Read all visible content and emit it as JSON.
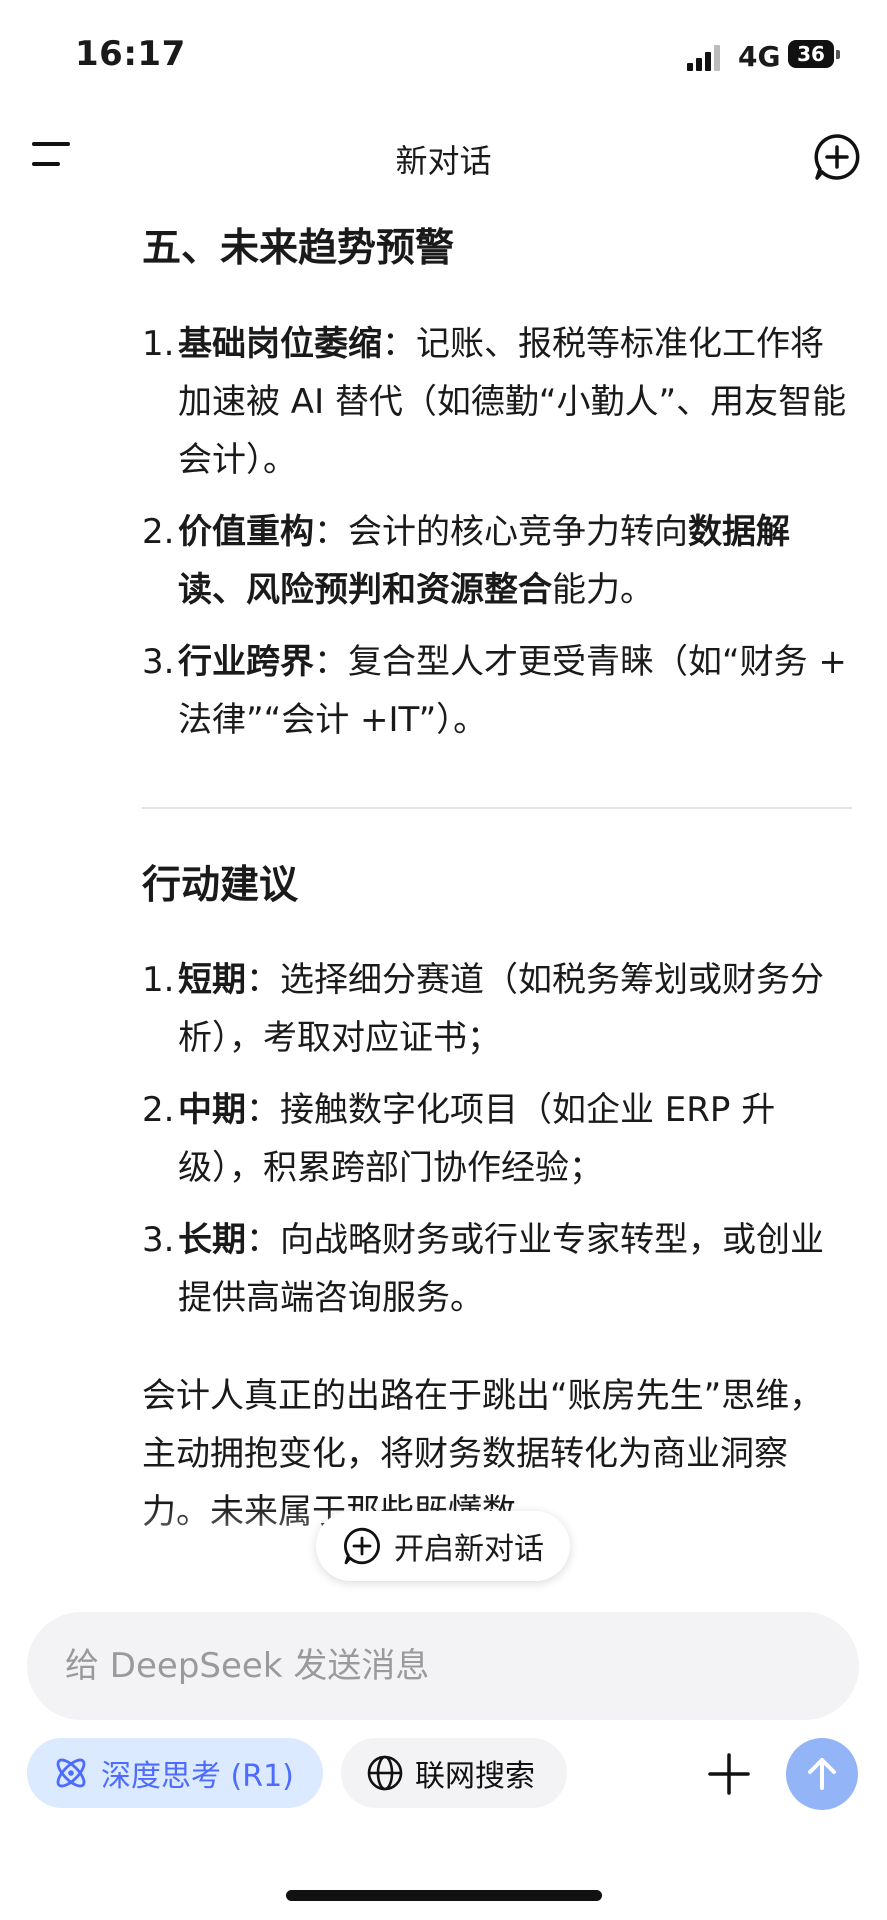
{
  "status_bar": {
    "time": "16:17",
    "network": "4G",
    "battery": "36"
  },
  "header": {
    "title": "新对话"
  },
  "section1": {
    "heading": "五、未来趋势预警",
    "items": [
      {
        "num": "1.",
        "bold": "基础岗位萎缩",
        "text": "：记账、报税等标准化工作将加速被 AI 替代（如德勤“小勤人”、用友智能会计）。"
      },
      {
        "num": "2.",
        "bold": "价值重构",
        "text_before": "：会计的核心竞争力转向",
        "bold2": "数据解读、风险预判和资源整合",
        "text_after": "能力。"
      },
      {
        "num": "3.",
        "bold": "行业跨界",
        "text": "：复合型人才更受青睐（如“财务 + 法律”“会计 +IT”）。"
      }
    ]
  },
  "section2": {
    "heading": "行动建议",
    "items": [
      {
        "num": "1.",
        "bold": "短期",
        "text": "：选择细分赛道（如税务筹划或财务分析），考取对应证书；"
      },
      {
        "num": "2.",
        "bold": "中期",
        "text": "：接触数字化项目（如企业 ERP 升级），积累跨部门协作经验；"
      },
      {
        "num": "3.",
        "bold": "长期",
        "text": "：向战略财务或行业专家转型，或创业提供高端咨询服务。"
      }
    ]
  },
  "final_paragraph": "会计人真正的出路在于跳出“账房先生”思维，主动拥抱变化，将财务数据转化为商业洞察力。未来属于那些既懂数",
  "floating_button": {
    "label": "开启新对话"
  },
  "composer": {
    "placeholder": "给 DeepSeek 发送消息",
    "deep_think_label": "深度思考 (R1)",
    "web_search_label": "联网搜索"
  },
  "colors": {
    "accent": "#4d6bfe",
    "send_button": "#93b4f7",
    "chip_active_bg": "#dbeafe"
  }
}
